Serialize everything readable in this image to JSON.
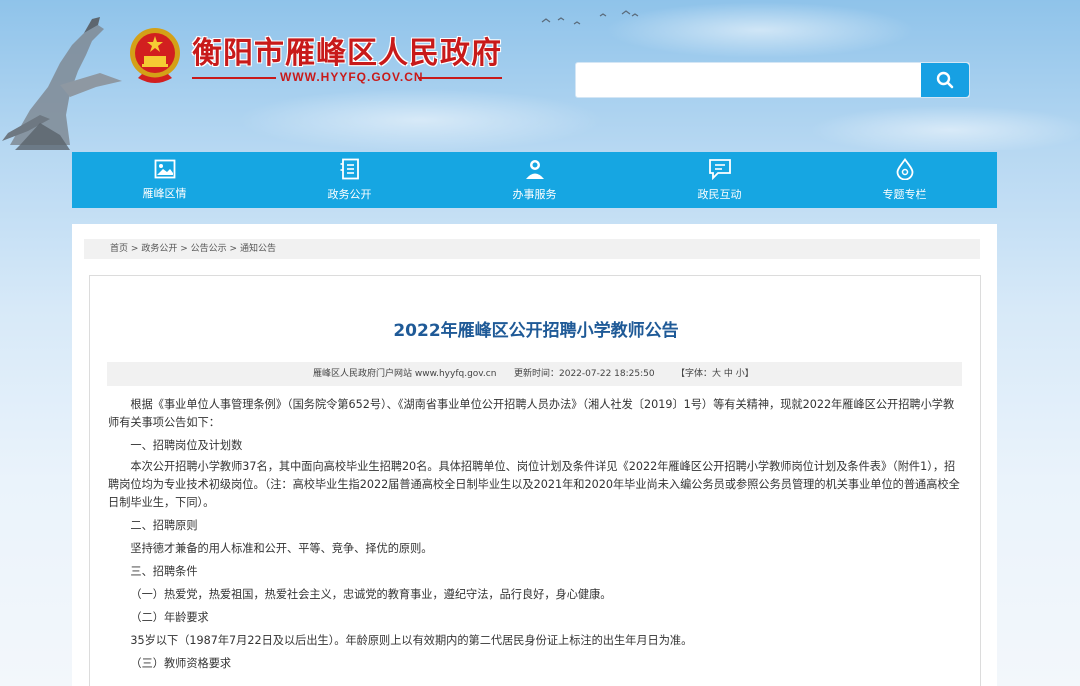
{
  "header": {
    "site_title": "衡阳市雁峰区人民政府",
    "site_url": "WWW.HYYFQ.GOV.CN",
    "search_placeholder": ""
  },
  "nav": {
    "items": [
      {
        "label": "雁峰区情",
        "icon": "image-icon"
      },
      {
        "label": "政务公开",
        "icon": "document-icon"
      },
      {
        "label": "办事服务",
        "icon": "person-icon"
      },
      {
        "label": "政民互动",
        "icon": "chat-icon"
      },
      {
        "label": "专题专栏",
        "icon": "drop-icon"
      }
    ]
  },
  "breadcrumb": {
    "items": [
      "首页",
      "政务公开",
      "公告公示",
      "通知公告"
    ],
    "separator": ">"
  },
  "article": {
    "title": "2022年雁峰区公开招聘小学教师公告",
    "source": "雁峰区人民政府门户网站 www.hyyfq.gov.cn",
    "updated": "更新时间：2022-07-22 18:25:50",
    "font_size_control": "【字体：大 中 小】",
    "paragraphs": [
      "根据《事业单位人事管理条例》（国务院令第652号）、《湖南省事业单位公开招聘人员办法》（湘人社发〔2019〕1号）等有关精神，现就2022年雁峰区公开招聘小学教师有关事项公告如下：",
      "一、招聘岗位及计划数",
      "本次公开招聘小学教师37名，其中面向高校毕业生招聘20名。具体招聘单位、岗位计划及条件详见《2022年雁峰区公开招聘小学教师岗位计划及条件表》（附件1），招聘岗位均为专业技术初级岗位。（注：高校毕业生指2022届普通高校全日制毕业生以及2021年和2020年毕业尚未入编公务员或参照公务员管理的机关事业单位的普通高校全日制毕业生，下同）。",
      "二、招聘原则",
      "坚持德才兼备的用人标准和公开、平等、竞争、择优的原则。",
      "三、招聘条件",
      "（一）热爱党，热爱祖国，热爱社会主义，忠诚党的教育事业，遵纪守法，品行良好，身心健康。",
      "（二）年龄要求",
      "35岁以下（1987年7月22日及以后出生）。年龄原则上以有效期内的第二代居民身份证上标注的出生年月日为准。",
      "（三）教师资格要求"
    ]
  },
  "colors": {
    "nav_bg": "#16a6e2",
    "title_red": "#c81a1a",
    "article_title_blue": "#1f5a97",
    "search_button": "#17a0e3"
  }
}
